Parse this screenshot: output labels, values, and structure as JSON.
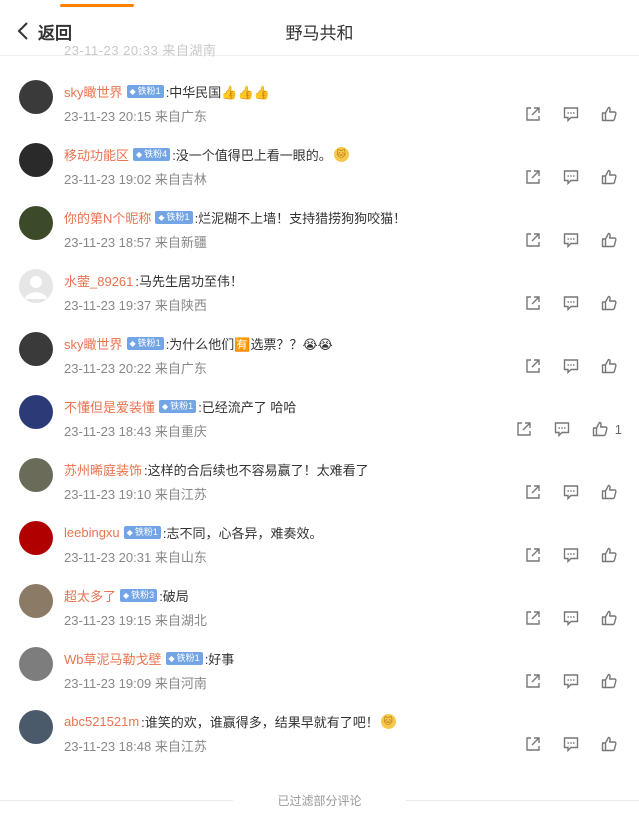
{
  "header": {
    "back_label": "返回",
    "title": "野马共和",
    "ghost_row": "23-11-23 20:33 来自湖南"
  },
  "comments": [
    {
      "user": "sky瞰世界",
      "badge": "铁粉1",
      "text": ":中华民国👍👍👍",
      "meta": "23-11-23 20:15 来自广东",
      "likes": "",
      "avatar": "#3a3a3a"
    },
    {
      "user": "移动功能区",
      "badge": "铁粉4",
      "text": ":没一个值得巴上看一眼的。",
      "meta": "23-11-23 19:02 来自吉林",
      "likes": "",
      "avatar": "#2a2a2a",
      "emoji": "🐱"
    },
    {
      "user": "你的第N个昵称",
      "badge": "铁粉1",
      "text": ":烂泥糊不上墙！支持猎捞狗狗咬猫！",
      "meta": "23-11-23 18:57 来自新疆",
      "likes": "",
      "avatar": "#3d4a2a"
    },
    {
      "user": "水蓥_89261",
      "badge": "",
      "text": ":马先生居功至伟！",
      "meta": "23-11-23 19:37 来自陕西",
      "likes": "",
      "avatar": "#e6e6e6"
    },
    {
      "user": "sky瞰世界",
      "badge": "铁粉1",
      "text": ":为什么他们🈶选票？？😭😭",
      "meta": "23-11-23 20:22 来自广东",
      "likes": "",
      "avatar": "#3a3a3a"
    },
    {
      "user": "不懂但是爱装懂",
      "badge": "铁粉1",
      "text": ":已经流产了 哈哈",
      "meta": "23-11-23 18:43 来自重庆",
      "likes": "1",
      "avatar": "#2c3a78"
    },
    {
      "user": "苏州晞庭装饰",
      "badge": "",
      "text": ":这样的合后续也不容易赢了！太难看了",
      "meta": "23-11-23 19:10 来自江苏",
      "likes": "",
      "avatar": "#6b6b5a"
    },
    {
      "user": "leebingxu",
      "badge": "铁粉1",
      "text": ":志不同，心各异，难奏效。",
      "meta": "23-11-23 20:31 来自山东",
      "likes": "",
      "avatar": "#b00000"
    },
    {
      "user": "超太多了",
      "badge": "铁粉3",
      "text": ":破局",
      "meta": "23-11-23 19:15 来自湖北",
      "likes": "",
      "avatar": "#8a7a66"
    },
    {
      "user": "Wb草泥马勒戈壁",
      "badge": "铁粉1",
      "text": ":好事",
      "meta": "23-11-23 19:09 来自河南",
      "likes": "",
      "avatar": "#7d7d7d"
    },
    {
      "user": "abc521521m",
      "badge": "",
      "text": ":谁笑的欢，谁赢得多，结果早就有了吧！",
      "meta": "23-11-23 18:48 来自江苏",
      "likes": "",
      "avatar": "#4a5a6a",
      "emoji": "🐱"
    }
  ],
  "footer": {
    "text": "已过滤部分评论"
  },
  "colors": {
    "accent": "#ff8200",
    "username": "#eb7350",
    "badge": "#73a5e6"
  },
  "icons": {
    "share": "share-icon",
    "comment": "comment-icon",
    "like": "like-icon"
  }
}
